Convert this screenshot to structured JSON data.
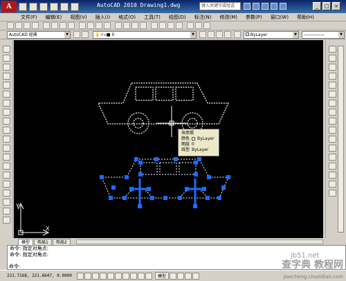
{
  "title": "AutoCAD 2010   Drawing1.dwg",
  "search_placeholder": "键入关键字或短语",
  "menu": [
    "文件(F)",
    "编辑(E)",
    "视图(V)",
    "插入(I)",
    "格式(O)",
    "工具(T)",
    "绘图(D)",
    "标注(N)",
    "修改(M)",
    "参数(P)",
    "窗口(W)",
    "帮助(H)"
  ],
  "workspace": "AutoCAD 经典",
  "layer": "0",
  "color": "ByLayer",
  "linetype": "ByLayer",
  "tooltip": {
    "title": "块参照",
    "rows": [
      {
        "label": "颜色",
        "value": "ByLayer",
        "swatch": true
      },
      {
        "label": "图层",
        "value": "0"
      },
      {
        "label": "线型",
        "value": "ByLayer"
      }
    ]
  },
  "tabs": [
    "模型",
    "布局1",
    "布局2"
  ],
  "command_lines": [
    "命令: 指定对角点:",
    "命令: 指定对角点:"
  ],
  "command_prompt": "命令:",
  "coords": "221.7168, 221.6647, 0.0000",
  "status_model": "模型",
  "watermark": {
    "site": "jb51.net",
    "brand": "查字典 教程网",
    "url": "jiaocheng.chazidian.com"
  },
  "ucs": {
    "x": "X",
    "y": "Y"
  },
  "colors": {
    "geometry": "#ffffff",
    "grip": "#1a6cff",
    "canvas": "#000000"
  }
}
